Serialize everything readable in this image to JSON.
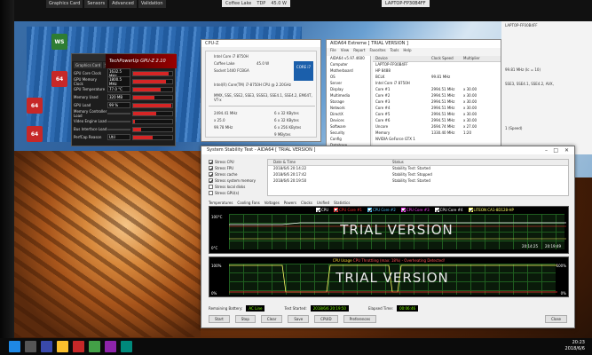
{
  "top_strip": {
    "tabs": [
      "Graphics Card",
      "Sensors",
      "Advanced",
      "Validation"
    ],
    "center": [
      "Coffee Lake",
      "TDP",
      "45.0 W"
    ],
    "right_label": "LAPTOP-FP30B4FF"
  },
  "desktop_icons": [
    {
      "label": "WS",
      "color": "#2e7d32"
    },
    {
      "label": "64",
      "color": "#c62828"
    },
    {
      "label": "64",
      "color": "#c62828"
    },
    {
      "label": "64",
      "color": "#c62828"
    }
  ],
  "gpuz": {
    "title": "TechPowerUp GPU-Z 2.10",
    "tabs": [
      "Graphics Card",
      "Sensors",
      "Advanced",
      "Validation"
    ],
    "rows": [
      {
        "label": "GPU Core Clock",
        "value": "1632.5 MHz",
        "fill": 0.9
      },
      {
        "label": "GPU Memory Clock",
        "value": "1800.5 MHz",
        "fill": 0.85
      },
      {
        "label": "GPU Temperature",
        "value": "77.0 °C",
        "fill": 0.7
      },
      {
        "label": "Memory Used",
        "value": "320 MB",
        "fill": 0.55
      },
      {
        "label": "GPU Load",
        "value": "99 %",
        "fill": 0.97
      },
      {
        "label": "Memory Controller Load",
        "value": "",
        "fill": 0.6
      },
      {
        "label": "Video Engine Load",
        "value": "",
        "fill": 0.05
      },
      {
        "label": "Bus Interface Load",
        "value": "",
        "fill": 0.2
      },
      {
        "label": "PerfCap Reason",
        "value": "Util",
        "fill": 0.5
      }
    ]
  },
  "cpuz": {
    "title": "CPU-Z",
    "name": "Intel Core i7 8750H",
    "codename": "Coffee Lake",
    "tdp": "45.0 W",
    "package": "Socket 1440 FCBGA",
    "spec": "Intel(R) Core(TM) i7-8750H CPU @ 2.20GHz",
    "logo_text": "CORE i7",
    "instructions": "MMX, SSE, SSE2, SSE3, SSSE3, SSE4.1, SSE4.2, EM64T, VT-x",
    "clocks": [
      "2494.41 MHz",
      "x 25.0",
      "99.78 MHz"
    ],
    "cache": [
      "6 x 32 KBytes",
      "6 x 32 KBytes",
      "6 x 256 KBytes",
      "9 MBytes"
    ]
  },
  "aida": {
    "title": "AIDA64 Extreme [ TRIAL VERSION ]",
    "menu": [
      "File",
      "View",
      "Report",
      "Favorites",
      "Tools",
      "Help"
    ],
    "tree": [
      "AIDA64 v5.97.4600",
      "Computer",
      "Motherboard",
      "OS",
      "Server",
      "Display",
      "Multimedia",
      "Storage",
      "Network",
      "DirectX",
      "Devices",
      "Software",
      "Security",
      "Config",
      "Database",
      "Benchmark"
    ],
    "columns": [
      "Device",
      "Clock Speed",
      "Multiplier"
    ],
    "rows": [
      {
        "device": "LAPTOP-FP30B4FF",
        "clock": "",
        "mult": ""
      },
      {
        "device": "HP 8488",
        "clock": "",
        "mult": ""
      },
      {
        "device": "BCLK",
        "clock": "99.81 MHz",
        "mult": ""
      },
      {
        "device": "Intel Core i7 8750H",
        "clock": "",
        "mult": ""
      },
      {
        "device": "Core #1",
        "clock": "2994.51 MHz",
        "mult": "x 30.00"
      },
      {
        "device": "Core #2",
        "clock": "2994.51 MHz",
        "mult": "x 30.00"
      },
      {
        "device": "Core #3",
        "clock": "2994.51 MHz",
        "mult": "x 30.00"
      },
      {
        "device": "Core #4",
        "clock": "2994.51 MHz",
        "mult": "x 30.00"
      },
      {
        "device": "Core #5",
        "clock": "2994.51 MHz",
        "mult": "x 30.00"
      },
      {
        "device": "Core #6",
        "clock": "2994.51 MHz",
        "mult": "x 30.00"
      },
      {
        "device": "Uncore",
        "clock": "2694.74 MHz",
        "mult": "x 27.00"
      },
      {
        "device": "Memory",
        "clock": "1330.40 MHz",
        "mult": "1:20"
      },
      {
        "device": "NVIDIA GeForce GTX 1",
        "clock": "",
        "mult": ""
      }
    ]
  },
  "right_panel": {
    "title": "LAPTOP-FP30B4FF",
    "lines": [
      "99.81 MHz (Ic = 10)",
      "SSE3, SSE4.1, SSE4.2, AVX,",
      "1 (Speed)"
    ]
  },
  "sst": {
    "title": "System Stability Test - AIDA64 [ TRIAL VERSION ]",
    "tests": [
      {
        "label": "Stress CPU",
        "checked": true
      },
      {
        "label": "Stress FPU",
        "checked": true
      },
      {
        "label": "Stress cache",
        "checked": true
      },
      {
        "label": "Stress system memory",
        "checked": true
      },
      {
        "label": "Stress local disks",
        "checked": false
      },
      {
        "label": "Stress GPU(s)",
        "checked": false
      }
    ],
    "log_columns": [
      "Date & Time",
      "Status"
    ],
    "log_rows": [
      {
        "time": "2018/6/6 20:14:22",
        "status": "Stability Test: Started"
      },
      {
        "time": "2018/6/6 20:17:42",
        "status": "Stability Test: Stopped"
      },
      {
        "time": "2018/6/6 20:19:50",
        "status": "Stability Test: Started"
      }
    ],
    "subtabs": [
      "Temperatures",
      "Cooling Fans",
      "Voltages",
      "Powers",
      "Clocks",
      "Unified",
      "Statistics"
    ],
    "graph1": {
      "legend": [
        "CPU",
        "CPU Core #1",
        "CPU Core #2",
        "CPU Core #3",
        "CPU Core #4",
        "LITEON CA1-8D128-HP"
      ],
      "legend_colors": [
        "#ffffff",
        "#ff3030",
        "#4fc3f7",
        "#ff44ff",
        "#ffffff",
        "#ffff66"
      ],
      "y_top": "100°C",
      "y_bottom": "0°C",
      "watermark": "TRIAL VERSION",
      "time_label": "20:14:25",
      "time_label2": "20:19:49"
    },
    "graph2": {
      "header": "CPU Usage",
      "header_alert": "CPU Throttling (max: 18%) - Overheating Detected!",
      "y_top": "100%",
      "y_bottom": "0%",
      "right_top": "100%",
      "right_bottom": "0%",
      "watermark": "TRIAL VERSION"
    },
    "status": {
      "battery_label": "Remaining Battery:",
      "battery_value": "AC Line",
      "started_label": "Test Started:",
      "started_value": "2018/6/6 20:19:50",
      "elapsed_label": "Elapsed Time:",
      "elapsed_value": "00:06:46"
    },
    "buttons": [
      "Start",
      "Stop",
      "Clear",
      "Save",
      "CPUID",
      "Preferences",
      "Close"
    ]
  },
  "taskbar": {
    "time": "20:23",
    "date": "2018/6/6"
  }
}
